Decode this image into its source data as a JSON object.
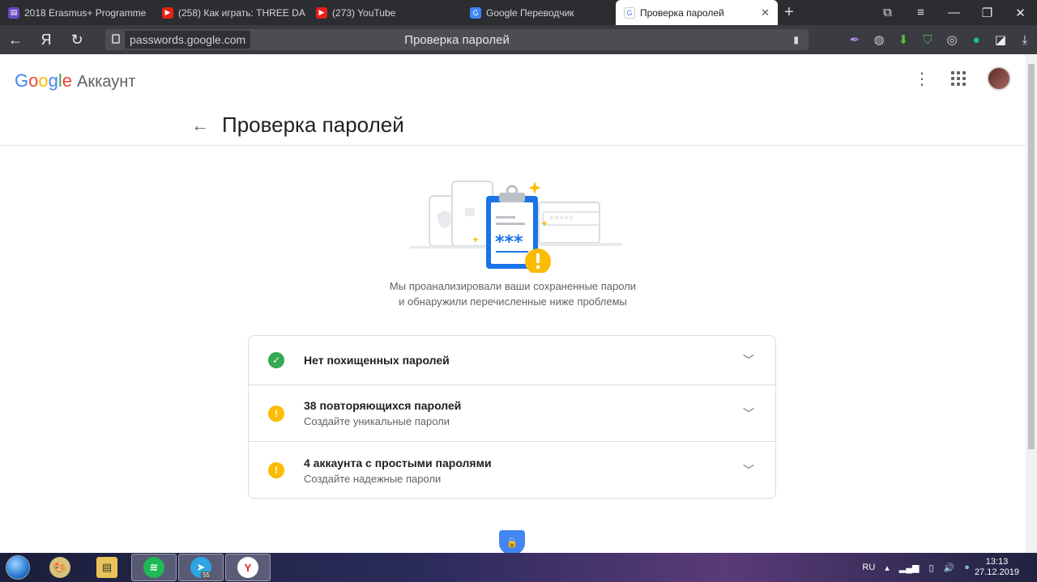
{
  "browser": {
    "tabs": [
      {
        "title": "2018 Erasmus+ Programme",
        "icon": "document-icon",
        "color": "#6a4cc2"
      },
      {
        "title": "(258) Как играть: THREE DA",
        "icon": "youtube-icon",
        "color": "#e62117"
      },
      {
        "title": "(273) YouTube",
        "icon": "youtube-icon",
        "color": "#e62117"
      },
      {
        "title": "Google Переводчик",
        "icon": "translate-icon",
        "color": "#4285f4"
      },
      {
        "title": "Проверка паролей",
        "icon": "google-icon",
        "color": "#4285f4"
      }
    ],
    "back_glyph": "←",
    "yandex_glyph": "Я",
    "reload_glyph": "↻",
    "url": "passwords.google.com",
    "page_title": "Проверка паролей"
  },
  "header": {
    "brand_letters": [
      "G",
      "o",
      "o",
      "g",
      "l",
      "e"
    ],
    "brand_colors": [
      "#4285f4",
      "#ea4335",
      "#fbbc05",
      "#4285f4",
      "#34a853",
      "#ea4335"
    ],
    "brand_suffix": "Аккаунт"
  },
  "main": {
    "back_arrow": "←",
    "title": "Проверка паролей",
    "illustration_stars": "***",
    "illustration_dots": "*****",
    "description_line1": "Мы проанализировали ваши сохраненные пароли",
    "description_line2": "и обнаружили перечисленные ниже проблемы",
    "results": [
      {
        "title": "Нет похищенных паролей",
        "subtitle": "",
        "status": "ok",
        "glyph": "✓"
      },
      {
        "title": "38 повторяющихся паролей",
        "subtitle": "Создайте уникальные пароли",
        "status": "warn",
        "glyph": "!"
      },
      {
        "title": "4 аккаунта с простыми паролями",
        "subtitle": "Создайте надежные пароли",
        "status": "warn",
        "glyph": "!"
      }
    ]
  },
  "taskbar": {
    "telegram_badge": "55",
    "language": "RU",
    "time": "13:13",
    "date": "27.12.2019"
  }
}
